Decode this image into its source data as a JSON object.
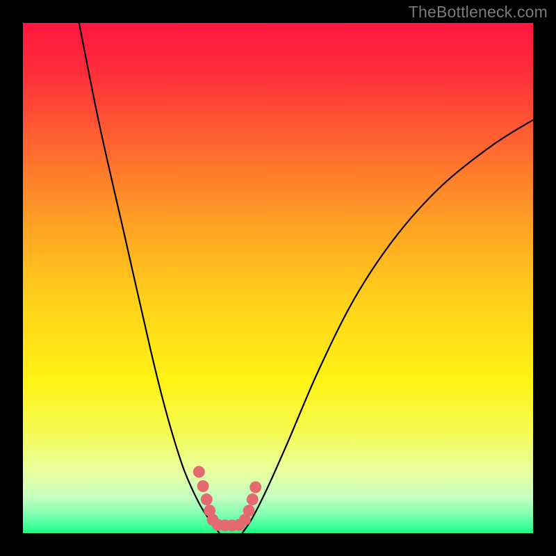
{
  "watermark": "TheBottleneck.com",
  "chart_data": {
    "type": "line",
    "title": "",
    "xlabel": "",
    "ylabel": "",
    "xlim": [
      0,
      100
    ],
    "ylim": [
      0,
      100
    ],
    "grid": false,
    "legend": false,
    "series": [
      {
        "name": "left-curve",
        "x": [
          11,
          15,
          20,
          25,
          28,
          31,
          33,
          35,
          37,
          38.5
        ],
        "y": [
          100,
          80,
          58,
          36,
          24,
          14,
          9,
          5,
          2,
          0
        ]
      },
      {
        "name": "right-curve",
        "x": [
          43,
          45,
          48,
          52,
          58,
          65,
          73,
          82,
          92,
          100
        ],
        "y": [
          0,
          3,
          9,
          18,
          32,
          46,
          58,
          68,
          76,
          81
        ]
      },
      {
        "name": "green-band-top",
        "x": [
          0,
          100
        ],
        "y": [
          3.2,
          3.2
        ]
      }
    ],
    "highlight_dots": {
      "name": "pink-dotted-v",
      "points": [
        {
          "x": 34.5,
          "y": 12.0
        },
        {
          "x": 35.3,
          "y": 9.2
        },
        {
          "x": 36.0,
          "y": 6.6
        },
        {
          "x": 36.6,
          "y": 4.4
        },
        {
          "x": 37.2,
          "y": 2.6
        },
        {
          "x": 38.2,
          "y": 1.6
        },
        {
          "x": 39.6,
          "y": 1.5
        },
        {
          "x": 41.0,
          "y": 1.5
        },
        {
          "x": 42.4,
          "y": 1.6
        },
        {
          "x": 43.5,
          "y": 2.6
        },
        {
          "x": 44.3,
          "y": 4.4
        },
        {
          "x": 45.0,
          "y": 6.6
        },
        {
          "x": 45.6,
          "y": 9.0
        }
      ]
    },
    "gradient_stops": [
      {
        "offset": 0.0,
        "color": "#ff153f"
      },
      {
        "offset": 0.1,
        "color": "#ff2f3a"
      },
      {
        "offset": 0.25,
        "color": "#ff6a2f"
      },
      {
        "offset": 0.4,
        "color": "#ffa324"
      },
      {
        "offset": 0.55,
        "color": "#ffd21a"
      },
      {
        "offset": 0.7,
        "color": "#fff314"
      },
      {
        "offset": 0.8,
        "color": "#f6fb52"
      },
      {
        "offset": 0.88,
        "color": "#e8ffa0"
      },
      {
        "offset": 0.93,
        "color": "#c4ffc0"
      },
      {
        "offset": 0.965,
        "color": "#7dffb0"
      },
      {
        "offset": 1.0,
        "color": "#1aff87"
      }
    ]
  }
}
